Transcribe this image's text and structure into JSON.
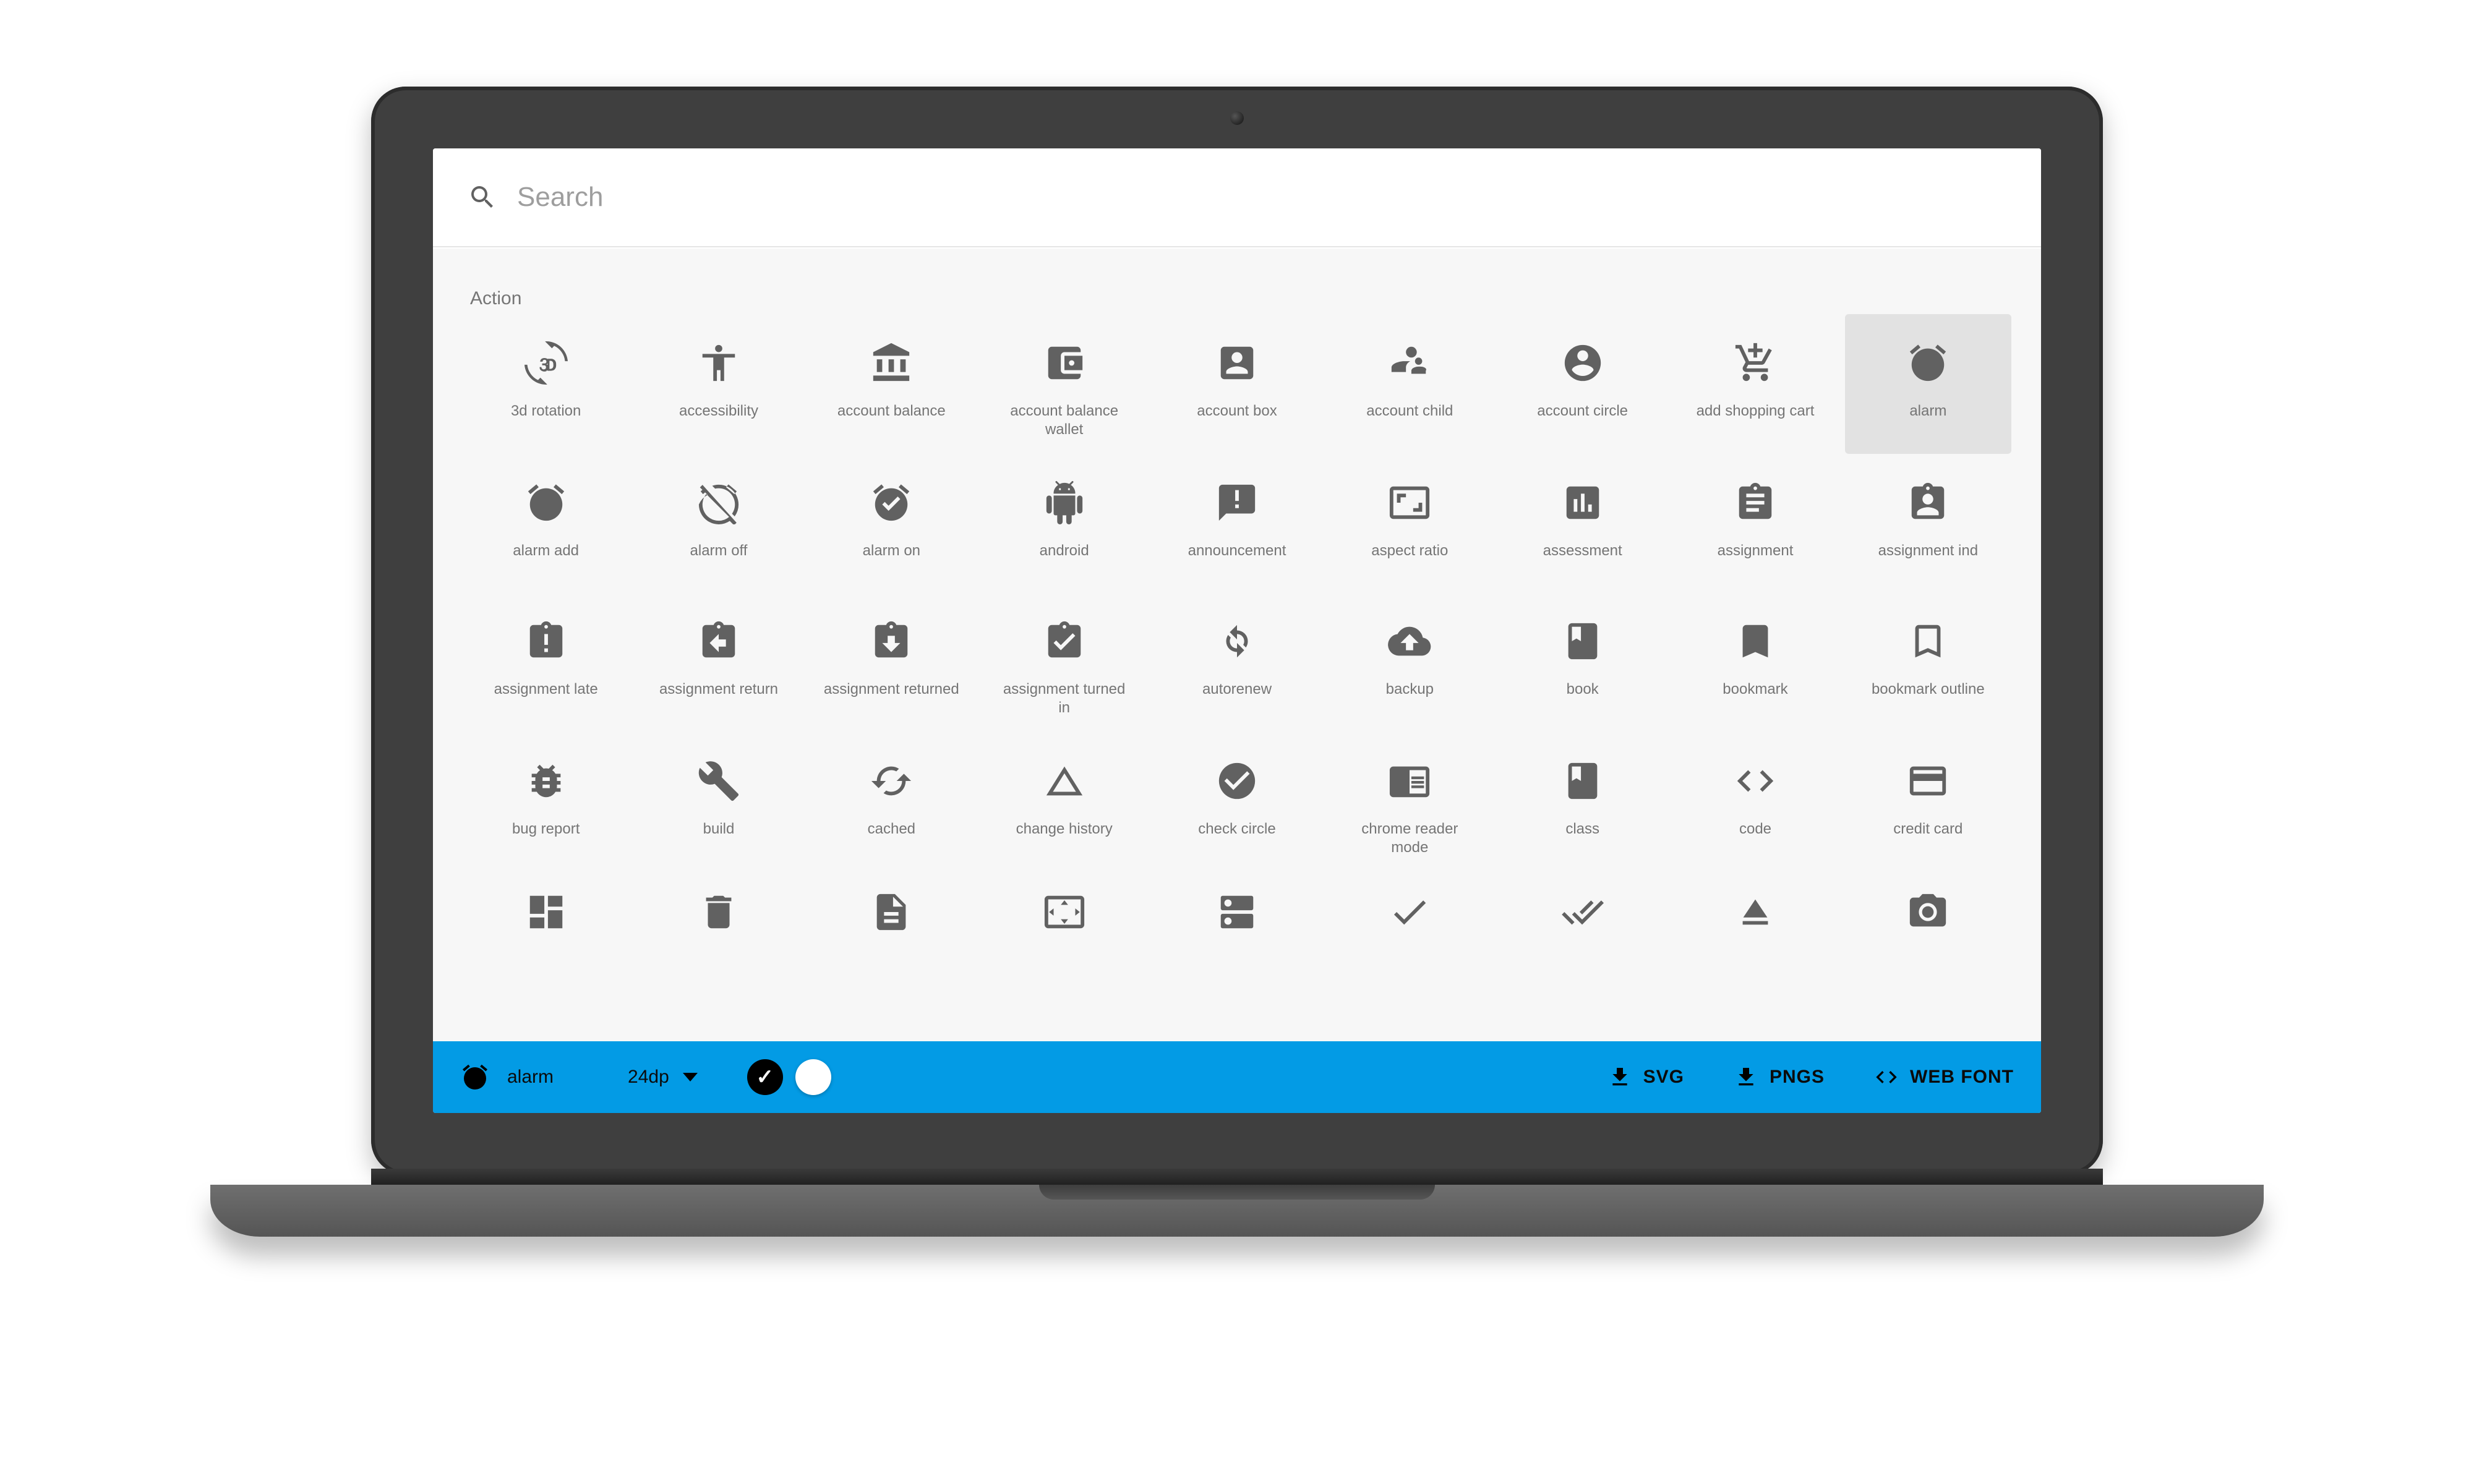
{
  "search": {
    "placeholder": "Search"
  },
  "section": {
    "title": "Action"
  },
  "icons": {
    "row1": [
      {
        "key": "3d-rotation",
        "label": "3d rotation"
      },
      {
        "key": "accessibility",
        "label": "accessibility"
      },
      {
        "key": "account-balance",
        "label": "account balance"
      },
      {
        "key": "account-balance-wallet",
        "label": "account balance wallet"
      },
      {
        "key": "account-box",
        "label": "account box"
      },
      {
        "key": "account-child",
        "label": "account child"
      },
      {
        "key": "account-circle",
        "label": "account circle"
      },
      {
        "key": "add-shopping-cart",
        "label": "add shopping cart"
      },
      {
        "key": "alarm",
        "label": "alarm",
        "selected": true
      }
    ],
    "row2": [
      {
        "key": "alarm-add",
        "label": "alarm add"
      },
      {
        "key": "alarm-off",
        "label": "alarm off"
      },
      {
        "key": "alarm-on",
        "label": "alarm on"
      },
      {
        "key": "android",
        "label": "android"
      },
      {
        "key": "announcement",
        "label": "announcement"
      },
      {
        "key": "aspect-ratio",
        "label": "aspect ratio"
      },
      {
        "key": "assessment",
        "label": "assessment"
      },
      {
        "key": "assignment",
        "label": "assignment"
      },
      {
        "key": "assignment-ind",
        "label": "assignment ind"
      }
    ],
    "row3": [
      {
        "key": "assignment-late",
        "label": "assignment late"
      },
      {
        "key": "assignment-return",
        "label": "assignment return"
      },
      {
        "key": "assignment-returned",
        "label": "assignment returned"
      },
      {
        "key": "assignment-turned-in",
        "label": "assignment turned in"
      },
      {
        "key": "autorenew",
        "label": "autorenew"
      },
      {
        "key": "backup",
        "label": "backup"
      },
      {
        "key": "book",
        "label": "book"
      },
      {
        "key": "bookmark",
        "label": "bookmark"
      },
      {
        "key": "bookmark-outline",
        "label": "bookmark outline"
      }
    ],
    "row4": [
      {
        "key": "bug-report",
        "label": "bug report"
      },
      {
        "key": "build",
        "label": "build"
      },
      {
        "key": "cached",
        "label": "cached"
      },
      {
        "key": "change-history",
        "label": "change history"
      },
      {
        "key": "check-circle",
        "label": "check circle"
      },
      {
        "key": "chrome-reader-mode",
        "label": "chrome reader mode"
      },
      {
        "key": "class",
        "label": "class"
      },
      {
        "key": "code",
        "label": "code"
      },
      {
        "key": "credit-card",
        "label": "credit card"
      }
    ],
    "row5": [
      {
        "key": "dashboard",
        "label": ""
      },
      {
        "key": "delete",
        "label": ""
      },
      {
        "key": "description",
        "label": ""
      },
      {
        "key": "dns",
        "label": ""
      },
      {
        "key": "storage",
        "label": ""
      },
      {
        "key": "done",
        "label": ""
      },
      {
        "key": "done-all",
        "label": ""
      },
      {
        "key": "eject",
        "label": ""
      },
      {
        "key": "camera-alt",
        "label": ""
      }
    ]
  },
  "actionbar": {
    "selected": {
      "key": "alarm",
      "label": "alarm"
    },
    "size": "24dp",
    "color_black_active": true,
    "downloads": {
      "svg": "SVG",
      "pngs": "PNGS",
      "webfont": "WEB FONT"
    }
  },
  "colors": {
    "accent": "#039be5",
    "icon": "#616161",
    "muted": "#757575"
  }
}
